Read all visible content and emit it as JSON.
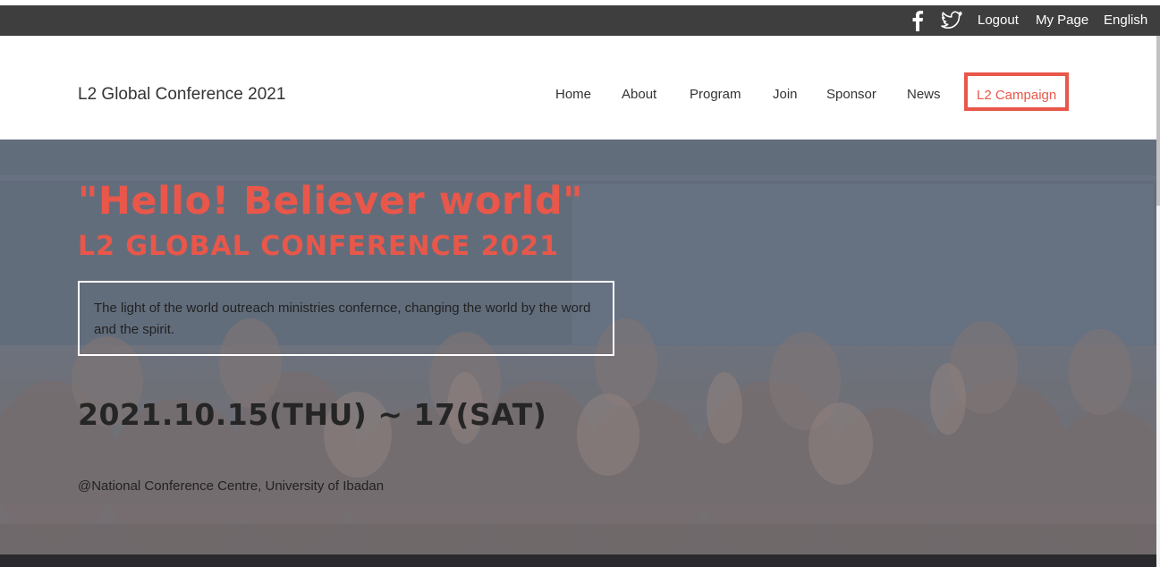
{
  "topbar": {
    "social": [
      {
        "icon": "facebook-icon"
      },
      {
        "icon": "twitter-icon"
      }
    ],
    "links": [
      "Logout",
      "My Page",
      "English"
    ]
  },
  "header": {
    "brand": "L2 Global Conference 2021",
    "nav": [
      "Home",
      "About",
      "Program",
      "Join",
      "Sponsor",
      "News",
      "L2 Campaign"
    ],
    "highlighted_nav": "L2 Campaign"
  },
  "hero": {
    "title": "\"Hello! Believer world\"",
    "subtitle": "L2 GLOBAL CONFERENCE 2021",
    "description": "The light of the world outreach ministries confernce, changing the world by the word and the spirit.",
    "dates": "2021.10.15(THU) ~ 17(SAT)",
    "venue": "@National Conference Centre, University of Ibadan"
  },
  "colors": {
    "accent": "#e8574a",
    "topbar": "#3e3e3e",
    "text_dark": "#333333"
  }
}
